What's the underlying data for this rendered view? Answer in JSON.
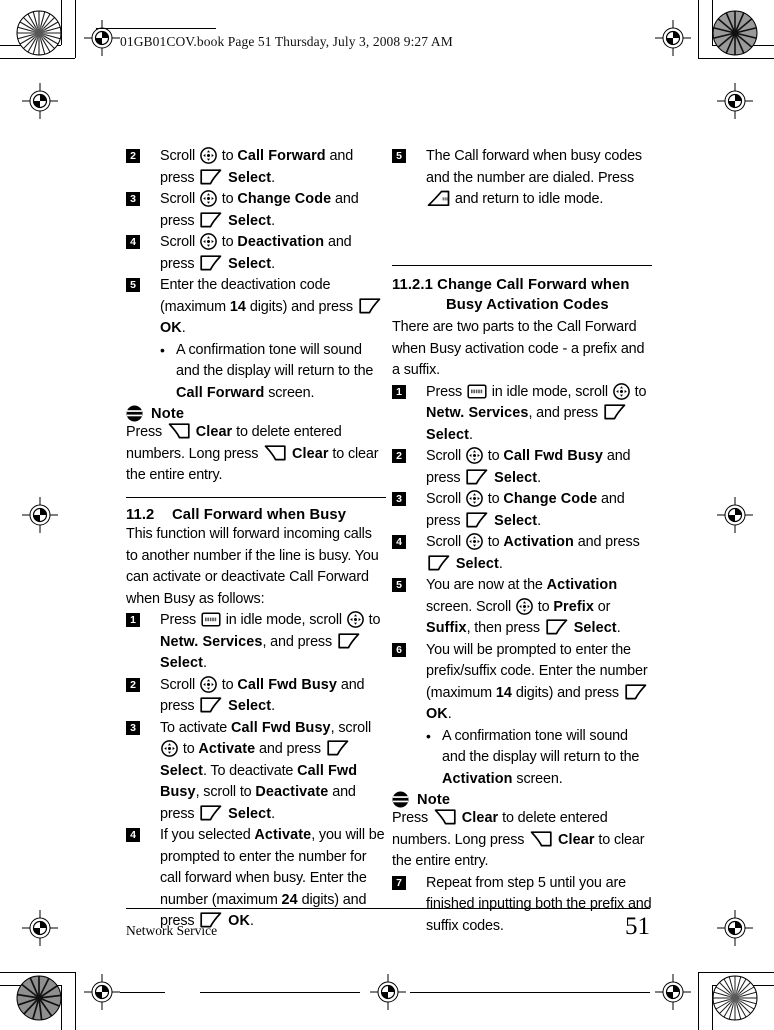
{
  "header": {
    "slug": "01GB01COV.book  Page 51  Thursday, July 3, 2008  9:27 AM"
  },
  "footer": {
    "left_text": "Network Service",
    "page_number": "51"
  },
  "icons": {
    "nav": "navigation-scroll-key-icon",
    "softkey": "left-soft-key-icon",
    "clear": "clear-key-icon",
    "menu": "menu-key-icon",
    "end_call": "end-call-key-icon",
    "note": "note-icon"
  },
  "left_column": {
    "steps_continued": [
      {
        "number": "2",
        "parts": [
          {
            "t": "text",
            "v": "Scroll "
          },
          {
            "t": "icon",
            "v": "nav"
          },
          {
            "t": "text",
            "v": " to "
          },
          {
            "t": "bold",
            "v": "Call Forward"
          },
          {
            "t": "text",
            "v": " and press "
          },
          {
            "t": "icon",
            "v": "softkey"
          },
          {
            "t": "text",
            "v": " "
          },
          {
            "t": "bold",
            "v": "Select"
          },
          {
            "t": "text",
            "v": "."
          }
        ]
      },
      {
        "number": "3",
        "parts": [
          {
            "t": "text",
            "v": "Scroll "
          },
          {
            "t": "icon",
            "v": "nav"
          },
          {
            "t": "text",
            "v": " to "
          },
          {
            "t": "bold",
            "v": "Change Code"
          },
          {
            "t": "text",
            "v": " and press "
          },
          {
            "t": "icon",
            "v": "softkey"
          },
          {
            "t": "text",
            "v": " "
          },
          {
            "t": "bold",
            "v": "Select"
          },
          {
            "t": "text",
            "v": "."
          }
        ]
      },
      {
        "number": "4",
        "parts": [
          {
            "t": "text",
            "v": "Scroll "
          },
          {
            "t": "icon",
            "v": "nav"
          },
          {
            "t": "text",
            "v": " to "
          },
          {
            "t": "bold",
            "v": "Deactivation"
          },
          {
            "t": "text",
            "v": " and press "
          },
          {
            "t": "icon",
            "v": "softkey"
          },
          {
            "t": "text",
            "v": " "
          },
          {
            "t": "bold",
            "v": "Select"
          },
          {
            "t": "text",
            "v": "."
          }
        ]
      },
      {
        "number": "5",
        "parts": [
          {
            "t": "text",
            "v": "Enter the deactivation code (maximum "
          },
          {
            "t": "bold",
            "v": "14"
          },
          {
            "t": "text",
            "v": " digits) and press "
          },
          {
            "t": "icon",
            "v": "softkey"
          },
          {
            "t": "text",
            "v": " "
          },
          {
            "t": "bold",
            "v": "OK"
          },
          {
            "t": "text",
            "v": "."
          }
        ]
      }
    ],
    "bullet": [
      {
        "t": "text",
        "v": "A confirmation tone will sound and the display will return to the "
      },
      {
        "t": "bold",
        "v": "Call Forward"
      },
      {
        "t": "text",
        "v": " screen."
      }
    ],
    "note": {
      "label": "Note",
      "parts": [
        {
          "t": "text",
          "v": "Press "
        },
        {
          "t": "icon",
          "v": "clear"
        },
        {
          "t": "text",
          "v": " "
        },
        {
          "t": "bold",
          "v": "Clear"
        },
        {
          "t": "text",
          "v": " to delete entered numbers. Long press "
        },
        {
          "t": "icon",
          "v": "clear"
        },
        {
          "t": "text",
          "v": " "
        },
        {
          "t": "bold",
          "v": "Clear"
        },
        {
          "t": "text",
          "v": " to clear the entire entry."
        }
      ]
    },
    "section": {
      "number": "11.2",
      "title": "Call Forward when Busy",
      "intro": "This function will forward incoming calls to another number if the line is busy. You can activate or deactivate Call Forward when Busy as follows:",
      "steps": [
        {
          "number": "1",
          "parts": [
            {
              "t": "text",
              "v": "Press "
            },
            {
              "t": "icon",
              "v": "menu"
            },
            {
              "t": "text",
              "v": " in idle mode, scroll "
            },
            {
              "t": "icon",
              "v": "nav"
            },
            {
              "t": "text",
              "v": " to "
            },
            {
              "t": "bold",
              "v": "Netw. Services"
            },
            {
              "t": "text",
              "v": ", and press "
            },
            {
              "t": "icon",
              "v": "softkey"
            },
            {
              "t": "text",
              "v": " "
            },
            {
              "t": "bold",
              "v": "Select"
            },
            {
              "t": "text",
              "v": "."
            }
          ]
        },
        {
          "number": "2",
          "parts": [
            {
              "t": "text",
              "v": "Scroll "
            },
            {
              "t": "icon",
              "v": "nav"
            },
            {
              "t": "text",
              "v": " to "
            },
            {
              "t": "bold",
              "v": "Call Fwd Busy"
            },
            {
              "t": "text",
              "v": " and press "
            },
            {
              "t": "icon",
              "v": "softkey"
            },
            {
              "t": "text",
              "v": " "
            },
            {
              "t": "bold",
              "v": "Select"
            },
            {
              "t": "text",
              "v": "."
            }
          ]
        },
        {
          "number": "3",
          "parts": [
            {
              "t": "text",
              "v": "To activate "
            },
            {
              "t": "bold",
              "v": "Call Fwd Busy"
            },
            {
              "t": "text",
              "v": ", scroll "
            },
            {
              "t": "icon",
              "v": "nav"
            },
            {
              "t": "text",
              "v": " to "
            },
            {
              "t": "bold",
              "v": "Activate"
            },
            {
              "t": "text",
              "v": " and press "
            },
            {
              "t": "icon",
              "v": "softkey"
            },
            {
              "t": "text",
              "v": " "
            },
            {
              "t": "bold",
              "v": "Select"
            },
            {
              "t": "text",
              "v": ". To deactivate "
            },
            {
              "t": "bold",
              "v": "Call Fwd Busy"
            },
            {
              "t": "text",
              "v": ", scroll to "
            },
            {
              "t": "bold",
              "v": "Deactivate"
            },
            {
              "t": "text",
              "v": " and press "
            },
            {
              "t": "icon",
              "v": "softkey"
            },
            {
              "t": "text",
              "v": " "
            },
            {
              "t": "bold",
              "v": "Select"
            },
            {
              "t": "text",
              "v": "."
            }
          ]
        },
        {
          "number": "4",
          "parts": [
            {
              "t": "text",
              "v": "If you selected "
            },
            {
              "t": "bold",
              "v": "Activate"
            },
            {
              "t": "text",
              "v": ", you will be prompted to enter the number for call forward when busy. Enter the number (maximum "
            },
            {
              "t": "bold",
              "v": "24"
            },
            {
              "t": "text",
              "v": " digits) and press "
            },
            {
              "t": "icon",
              "v": "softkey"
            },
            {
              "t": "text",
              "v": " "
            },
            {
              "t": "bold",
              "v": "OK"
            },
            {
              "t": "text",
              "v": "."
            }
          ]
        }
      ]
    }
  },
  "right_column": {
    "step_five": {
      "number": "5",
      "parts": [
        {
          "t": "text",
          "v": "The Call forward when busy codes and the number are dialed. Press "
        },
        {
          "t": "icon",
          "v": "end_call"
        },
        {
          "t": "text",
          "v": " and return to idle mode."
        }
      ]
    },
    "section": {
      "number": "11.2.1",
      "title_line1": "Change Call Forward when",
      "title_line2": "Busy Activation Codes",
      "intro": "There are two parts to the Call Forward when Busy activation code - a prefix and a suffix.",
      "steps": [
        {
          "number": "1",
          "parts": [
            {
              "t": "text",
              "v": "Press "
            },
            {
              "t": "icon",
              "v": "menu"
            },
            {
              "t": "text",
              "v": " in idle mode, scroll "
            },
            {
              "t": "icon",
              "v": "nav"
            },
            {
              "t": "text",
              "v": " to "
            },
            {
              "t": "bold",
              "v": "Netw. Services"
            },
            {
              "t": "text",
              "v": ", and press "
            },
            {
              "t": "icon",
              "v": "softkey"
            },
            {
              "t": "text",
              "v": " "
            },
            {
              "t": "bold",
              "v": "Select"
            },
            {
              "t": "text",
              "v": "."
            }
          ]
        },
        {
          "number": "2",
          "parts": [
            {
              "t": "text",
              "v": "Scroll "
            },
            {
              "t": "icon",
              "v": "nav"
            },
            {
              "t": "text",
              "v": " to "
            },
            {
              "t": "bold",
              "v": "Call Fwd Busy"
            },
            {
              "t": "text",
              "v": " and press "
            },
            {
              "t": "icon",
              "v": "softkey"
            },
            {
              "t": "text",
              "v": " "
            },
            {
              "t": "bold",
              "v": "Select"
            },
            {
              "t": "text",
              "v": "."
            }
          ]
        },
        {
          "number": "3",
          "parts": [
            {
              "t": "text",
              "v": "Scroll "
            },
            {
              "t": "icon",
              "v": "nav"
            },
            {
              "t": "text",
              "v": " to "
            },
            {
              "t": "bold",
              "v": "Change Code"
            },
            {
              "t": "text",
              "v": " and press "
            },
            {
              "t": "icon",
              "v": "softkey"
            },
            {
              "t": "text",
              "v": " "
            },
            {
              "t": "bold",
              "v": "Select"
            },
            {
              "t": "text",
              "v": "."
            }
          ]
        },
        {
          "number": "4",
          "parts": [
            {
              "t": "text",
              "v": "Scroll "
            },
            {
              "t": "icon",
              "v": "nav"
            },
            {
              "t": "text",
              "v": " to "
            },
            {
              "t": "bold",
              "v": "Activation"
            },
            {
              "t": "text",
              "v": " and press "
            },
            {
              "t": "icon",
              "v": "softkey"
            },
            {
              "t": "text",
              "v": " "
            },
            {
              "t": "bold",
              "v": "Select"
            },
            {
              "t": "text",
              "v": "."
            }
          ]
        },
        {
          "number": "5",
          "parts": [
            {
              "t": "text",
              "v": "You are now at the "
            },
            {
              "t": "bold",
              "v": "Activation"
            },
            {
              "t": "text",
              "v": " screen. Scroll "
            },
            {
              "t": "icon",
              "v": "nav"
            },
            {
              "t": "text",
              "v": " to "
            },
            {
              "t": "bold",
              "v": "Prefix"
            },
            {
              "t": "text",
              "v": " or "
            },
            {
              "t": "bold",
              "v": "Suffix"
            },
            {
              "t": "text",
              "v": ", then press "
            },
            {
              "t": "icon",
              "v": "softkey"
            },
            {
              "t": "text",
              "v": " "
            },
            {
              "t": "bold",
              "v": "Select"
            },
            {
              "t": "text",
              "v": "."
            }
          ]
        },
        {
          "number": "6",
          "parts": [
            {
              "t": "text",
              "v": "You will be prompted to enter the prefix/suffix code. Enter the number (maximum "
            },
            {
              "t": "bold",
              "v": "14"
            },
            {
              "t": "text",
              "v": " digits) and press "
            },
            {
              "t": "icon",
              "v": "softkey"
            },
            {
              "t": "text",
              "v": " "
            },
            {
              "t": "bold",
              "v": "OK"
            },
            {
              "t": "text",
              "v": "."
            }
          ]
        }
      ],
      "bullet": [
        {
          "t": "text",
          "v": "A confirmation tone will sound and the display will return to the "
        },
        {
          "t": "bold",
          "v": "Activation"
        },
        {
          "t": "text",
          "v": " screen."
        }
      ],
      "note": {
        "label": "Note",
        "parts": [
          {
            "t": "text",
            "v": "Press "
          },
          {
            "t": "icon",
            "v": "clear"
          },
          {
            "t": "text",
            "v": " "
          },
          {
            "t": "bold",
            "v": "Clear"
          },
          {
            "t": "text",
            "v": " to delete entered numbers. Long press "
          },
          {
            "t": "icon",
            "v": "clear"
          },
          {
            "t": "text",
            "v": " "
          },
          {
            "t": "bold",
            "v": "Clear"
          },
          {
            "t": "text",
            "v": " to clear the entire entry."
          }
        ]
      },
      "final_step": {
        "number": "7",
        "parts": [
          {
            "t": "text",
            "v": "Repeat from step 5 until you are finished inputting both the prefix and suffix codes."
          }
        ]
      }
    }
  }
}
